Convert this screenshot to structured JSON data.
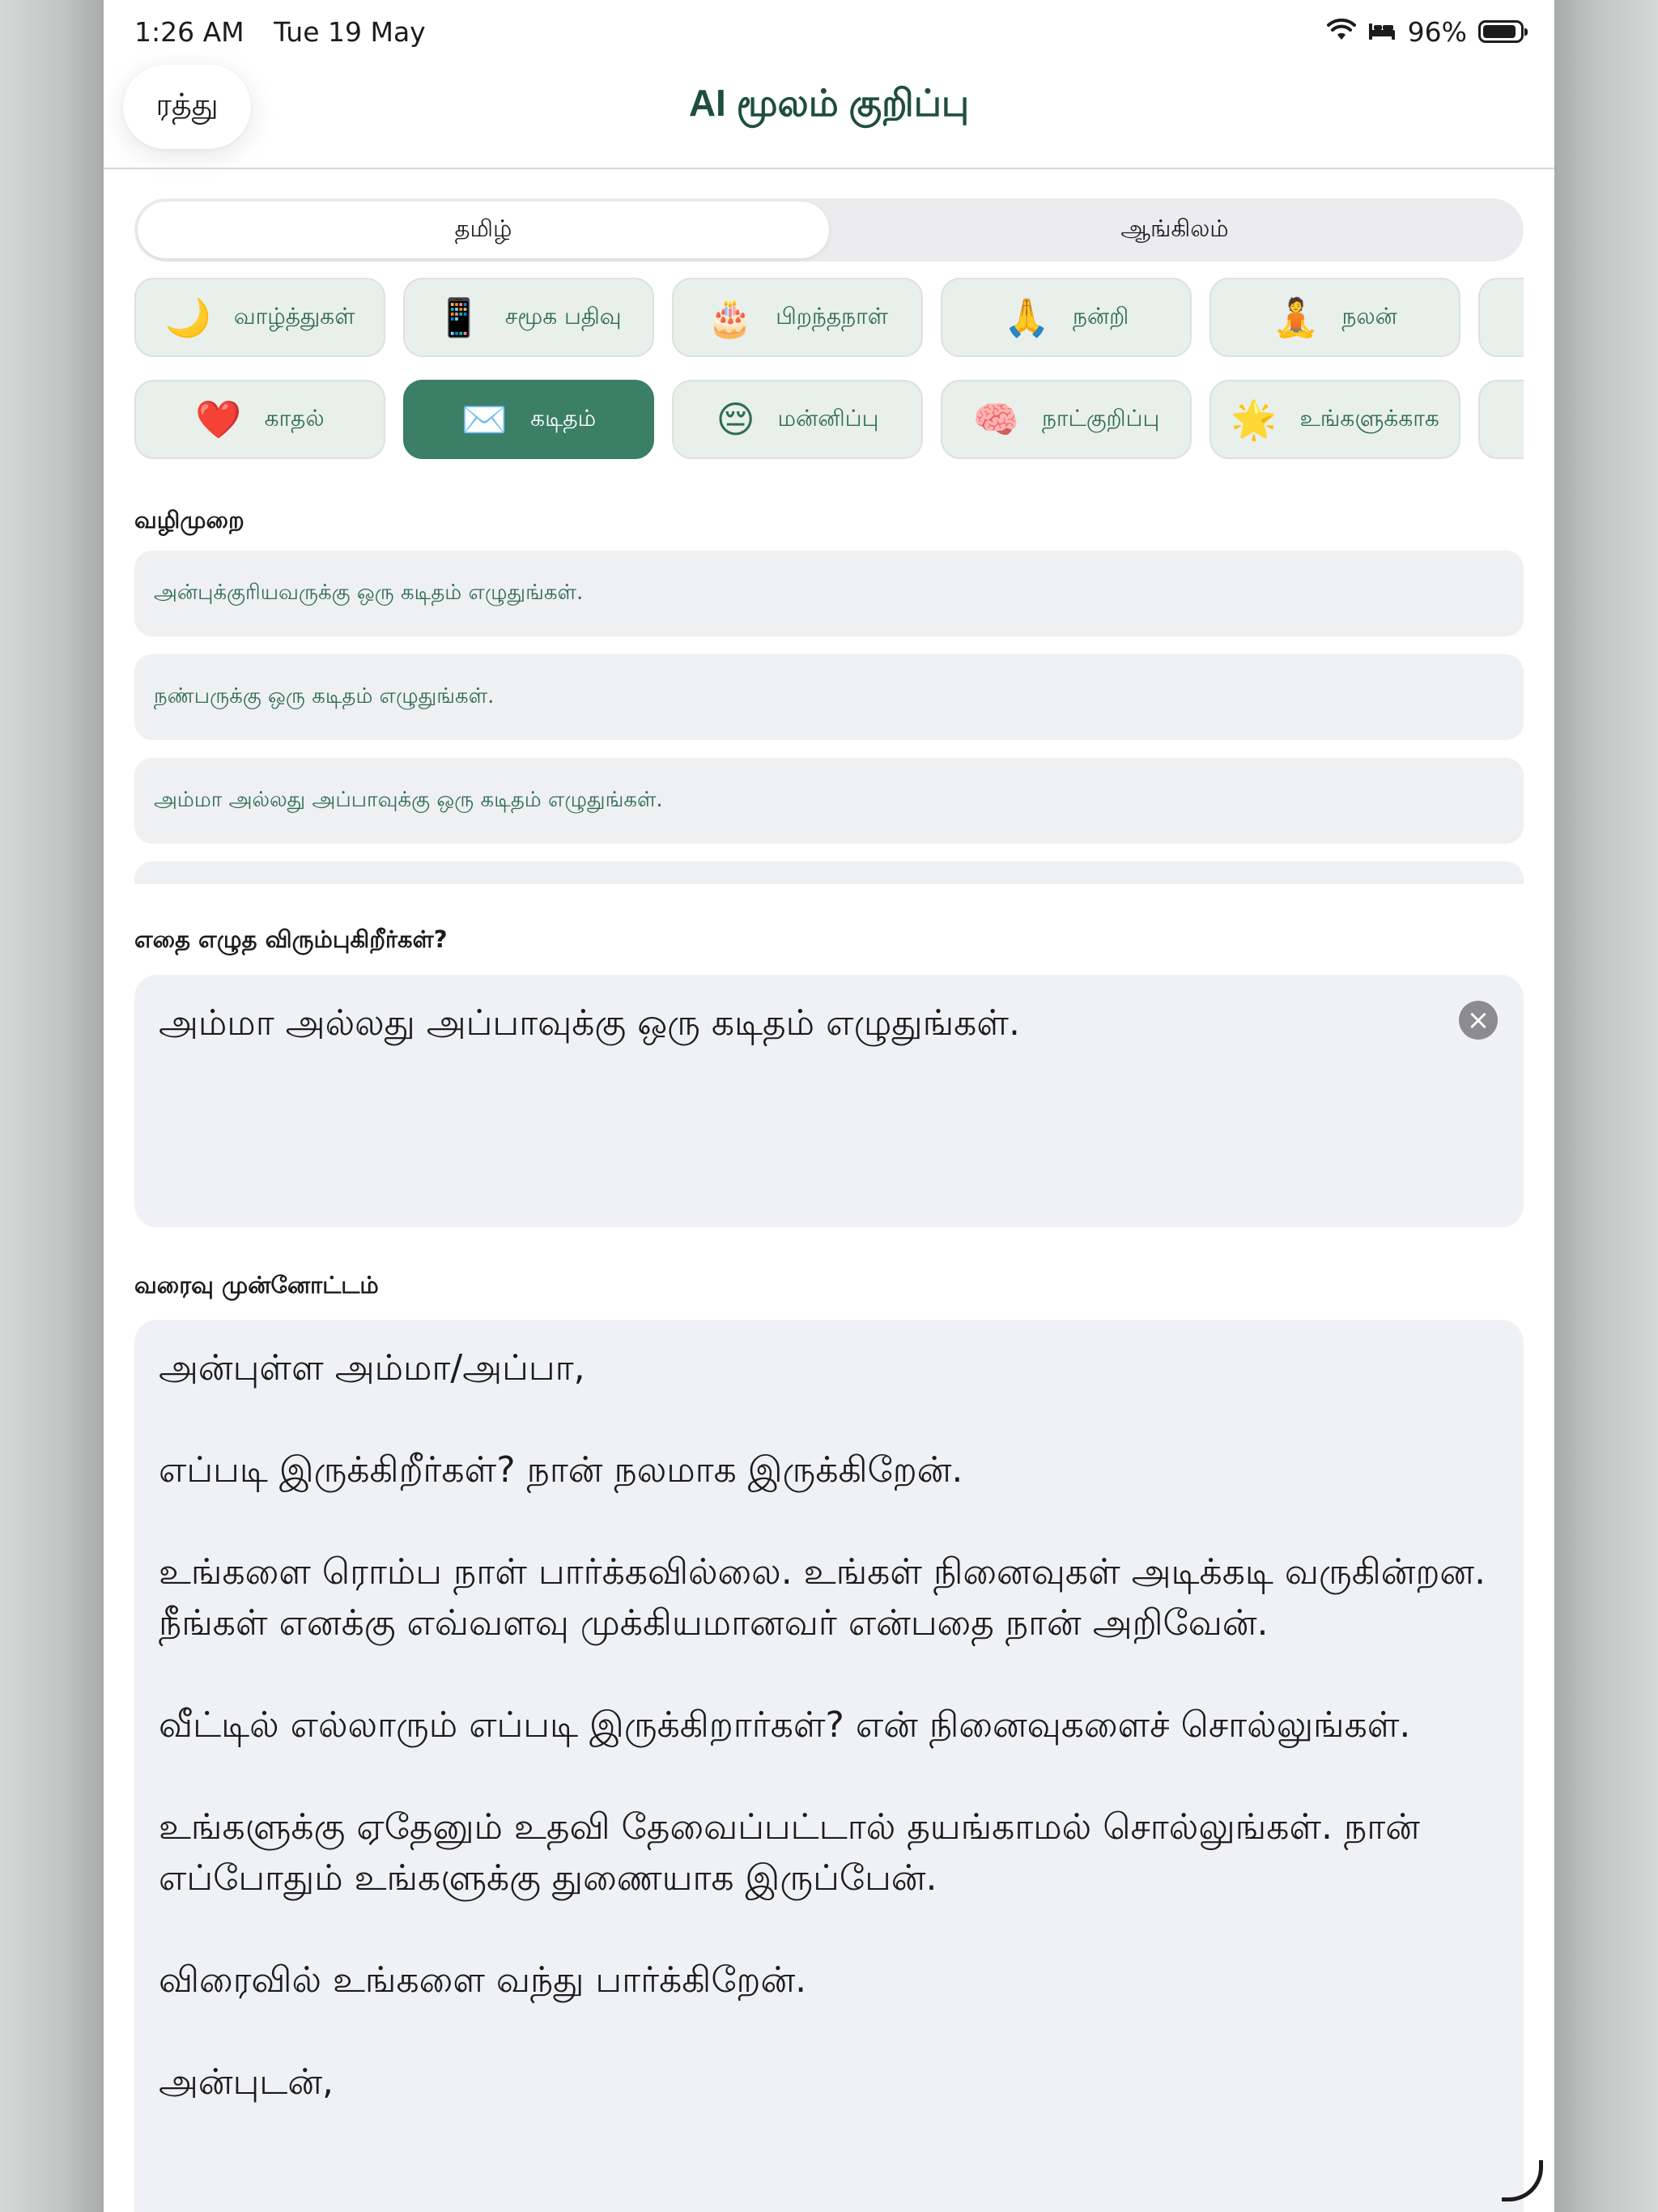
{
  "status_bar": {
    "time": "1:26 AM",
    "date": "Tue 19 May",
    "battery": "96%",
    "icons": [
      "wifi-icon",
      "bed-icon",
      "battery-icon"
    ]
  },
  "nav": {
    "cancel_label": "ரத்து",
    "title": "AI மூலம் குறிப்பு"
  },
  "language_tabs": [
    {
      "label": "தமிழ்",
      "selected": true
    },
    {
      "label": "ஆங்கிலம்",
      "selected": false
    }
  ],
  "categories_row1": [
    {
      "emoji": "🌙",
      "label": "வாழ்த்துகள்"
    },
    {
      "emoji": "📱",
      "label": "சமூக பதிவு"
    },
    {
      "emoji": "🎂",
      "label": "பிறந்தநாள்"
    },
    {
      "emoji": "🙏",
      "label": "நன்றி"
    },
    {
      "emoji": "🧘",
      "label": "நலன்"
    }
  ],
  "categories_row2": [
    {
      "emoji": "❤️",
      "label": "காதல்"
    },
    {
      "emoji": "✉️",
      "label": "கடிதம்",
      "selected": true
    },
    {
      "emoji": "😔",
      "label": "மன்னிப்பு"
    },
    {
      "emoji": "🧠",
      "label": "நாட்குறிப்பு"
    },
    {
      "emoji": "🌟",
      "label": "உங்களுக்காக"
    }
  ],
  "suggestions_label": "வழிமுறை",
  "suggestions": [
    "அன்புக்குரியவருக்கு ஒரு கடிதம் எழுதுங்கள்.",
    "நண்பருக்கு ஒரு கடிதம் எழுதுங்கள்.",
    "அம்மா அல்லது அப்பாவுக்கு ஒரு கடிதம் எழுதுங்கள்."
  ],
  "prompt_label": "எதை எழுத விரும்புகிறீர்கள்?",
  "prompt_value": "அம்மா அல்லது அப்பாவுக்கு ஒரு கடிதம் எழுதுங்கள்.",
  "preview_label": "வரைவு முன்னோட்டம்",
  "preview_text": "அன்புள்ள அம்மா/அப்பா,\n\nஎப்படி இருக்கிறீர்கள்? நான் நலமாக இருக்கிறேன்.\n\nஉங்களை ரொம்ப நாள் பார்க்கவில்லை. உங்கள் நினைவுகள் அடிக்கடி வருகின்றன. நீங்கள் எனக்கு எவ்வளவு முக்கியமானவர் என்பதை நான் அறிவேன்.\n\nவீட்டில் எல்லாரும் எப்படி இருக்கிறார்கள்? என் நினைவுகளைச் சொல்லுங்கள்.\n\nஉங்களுக்கு ஏதேனும் உதவி தேவைப்பட்டால் தயங்காமல் சொல்லுங்கள். நான் எப்போதும் உங்களுக்கு துணையாக இருப்பேன்.\n\nவிரைவில் உங்களை வந்து பார்க்கிறேன்.\n\nஅன்புடன்,",
  "colors": {
    "accent": "#3a7f66",
    "title": "#1f4f3c",
    "chip_bg": "#e9efeb",
    "field_bg": "#f0f1f4"
  }
}
